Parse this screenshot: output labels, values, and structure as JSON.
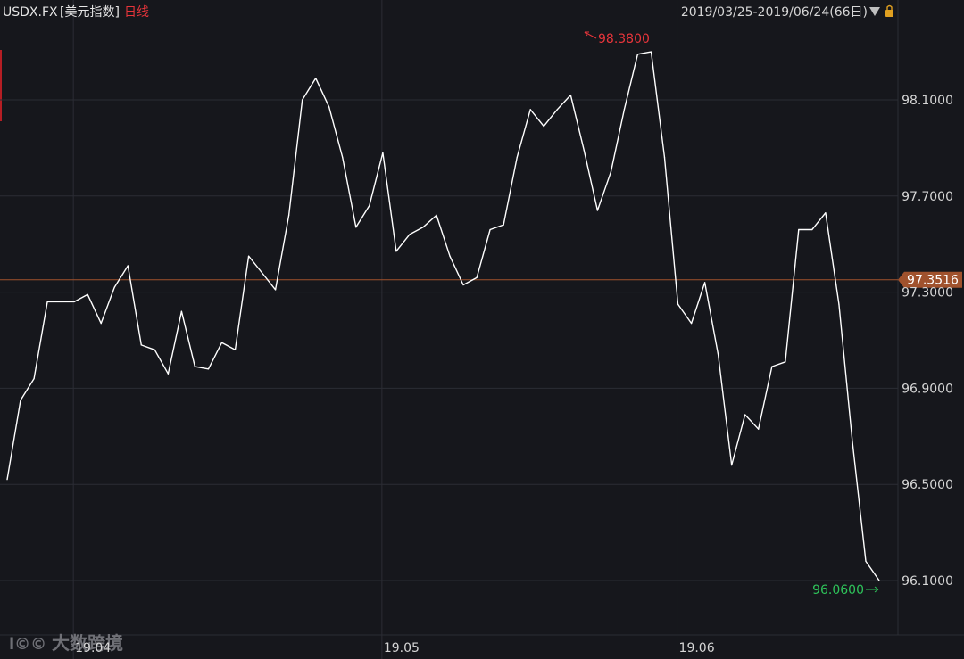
{
  "header": {
    "symbol": "USDX.FX",
    "name": "[美元指数]",
    "period": "日线",
    "date_range": "2019/03/25-2019/06/24(66日)",
    "dropdown_icon": "triangle-down-icon",
    "lock_icon": "lock-icon"
  },
  "watermark": "大数跨境",
  "colors": {
    "background": "#16171c",
    "line": "#ffffff",
    "grid": "#2b2d34",
    "axis_text": "#d6d6d6",
    "max_label": "#e8353b",
    "min_label": "#2ec45a",
    "current_line": "#a0522d",
    "current_tag": "#a0522d"
  },
  "chart_data": {
    "type": "line",
    "title": "",
    "series": [
      {
        "values": [
          96.52,
          96.85,
          96.94,
          97.26,
          97.26,
          97.26,
          97.29,
          97.17,
          97.32,
          97.41,
          97.08,
          97.06,
          96.96,
          97.22,
          96.99,
          96.98,
          97.09,
          97.06,
          97.45,
          97.38,
          97.31,
          97.62,
          98.1,
          98.19,
          98.07,
          97.86,
          97.57,
          97.66,
          97.88,
          97.47,
          97.54,
          97.57,
          97.62,
          97.45,
          97.33,
          97.36,
          97.56,
          97.58,
          97.86,
          98.06,
          97.99,
          98.06,
          98.12,
          97.89,
          97.64,
          97.8,
          98.06,
          98.29,
          98.3,
          97.86,
          97.25,
          97.17,
          97.34,
          97.04,
          96.58,
          96.79,
          96.73,
          96.99,
          97.01,
          97.56,
          97.56,
          97.63,
          97.25,
          96.68,
          96.18,
          96.1
        ]
      }
    ],
    "x_labels": [
      "19.04",
      "19.05",
      "19.06"
    ],
    "y_ticks": [
      "98.1000",
      "97.7000",
      "97.3000",
      "96.9000",
      "96.5000",
      "96.1000"
    ],
    "ylim": [
      95.9,
      98.45
    ],
    "max_value": 98.38,
    "max_label": "98.3800",
    "min_value": 96.06,
    "min_label": "96.0600",
    "current_value": 97.3516,
    "current_label": "97.3516",
    "grid": true
  }
}
